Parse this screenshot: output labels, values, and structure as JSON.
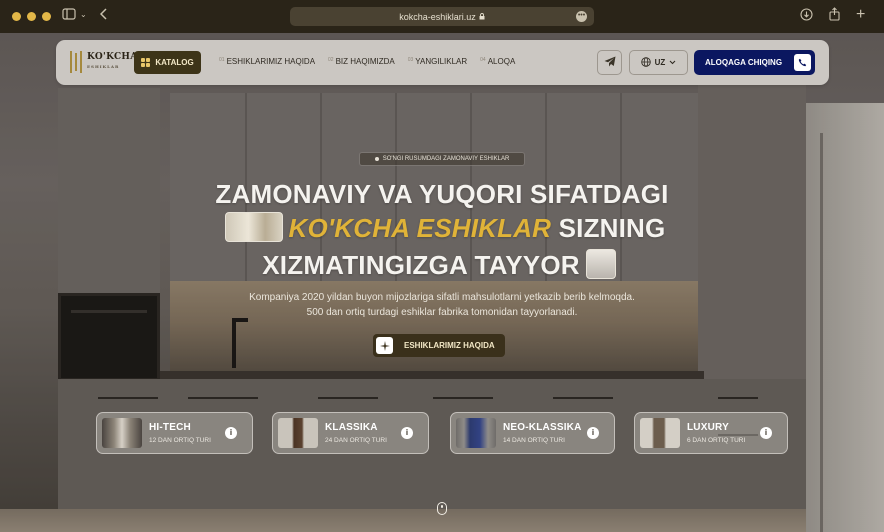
{
  "browser": {
    "url": "kokcha-eshiklari.uz",
    "lock_icon": "lock-icon"
  },
  "header": {
    "logo_text": "KO'KCHA",
    "logo_sub": "ESHIKLAR",
    "catalog_label": "KATALOG",
    "nav": [
      {
        "num": "01",
        "label": "ESHIKLARIMIZ HAQIDA"
      },
      {
        "num": "02",
        "label": "BIZ HAQIMIZDA"
      },
      {
        "num": "03",
        "label": "YANGILIKLAR"
      },
      {
        "num": "04",
        "label": "ALOQA"
      }
    ],
    "language": "UZ",
    "contact_label": "ALOQAGA CHIQING"
  },
  "hero": {
    "badge": "SO'NGI RUSUMDAGI ZAMONAVIY ESHIKLAR",
    "line1": "ZAMONAVIY VA YUQORI SIFATDAGI",
    "brand": "KO'KCHA ESHIKLAR",
    "line2_rest": "SIZNING",
    "line3": "XIZMATINGIZGA TAYYOR",
    "desc1": "Kompaniya 2020 yildan buyon mijozlariga sifatli mahsulotlarni yetkazib berib kelmoqda.",
    "desc2": "500 dan ortiq turdagi eshiklar fabrika tomonidan tayyorlanadi.",
    "cta_label": "ESHIKLARIMIZ HAQIDA"
  },
  "categories": [
    {
      "name": "HI-TECH",
      "count": "12 DAN ORTIQ TURI"
    },
    {
      "name": "KLASSIKA",
      "count": "24 DAN ORTIQ TURI"
    },
    {
      "name": "NEO-KLASSIKA",
      "count": "14 DAN ORTIQ TURI"
    },
    {
      "name": "LUXURY",
      "count": "6 DAN ORTIQ TURI"
    }
  ],
  "colors": {
    "brand_gold": "#e0b338",
    "contact_button": "#0b1760",
    "catalog_button": "#3d3418"
  }
}
